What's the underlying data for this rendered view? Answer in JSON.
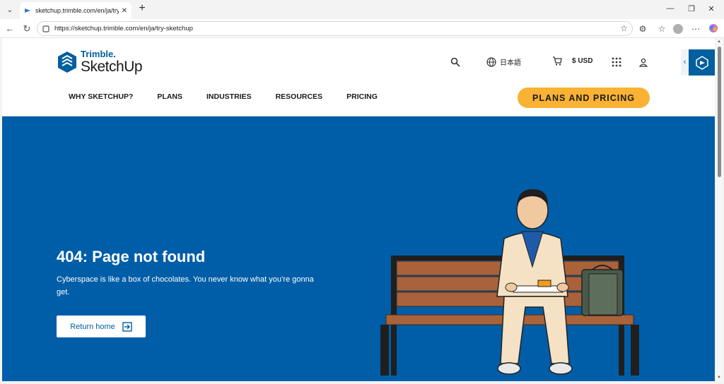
{
  "browser": {
    "tab_title": "sketchup.trimble.com/en/ja/try-sketchup",
    "url": "https://sketchup.trimble.com/en/ja/try-sketchup",
    "new_tab": "+"
  },
  "header": {
    "brand_top": "Trimble.",
    "brand_bottom": "SketchUp",
    "language": "日本語",
    "currency": "$ USD"
  },
  "nav": {
    "items": [
      "WHY SKETCHUP?",
      "PLANS",
      "INDUSTRIES",
      "RESOURCES",
      "PRICING"
    ],
    "cta": "PLANS AND PRICING"
  },
  "hero": {
    "title": "404: Page not found",
    "message": "Cyberspace is like a box of chocolates. You never know what you’re gonna get.",
    "button": "Return home"
  },
  "colors": {
    "brand_blue": "#005ea8",
    "cta_yellow": "#f9b233"
  }
}
